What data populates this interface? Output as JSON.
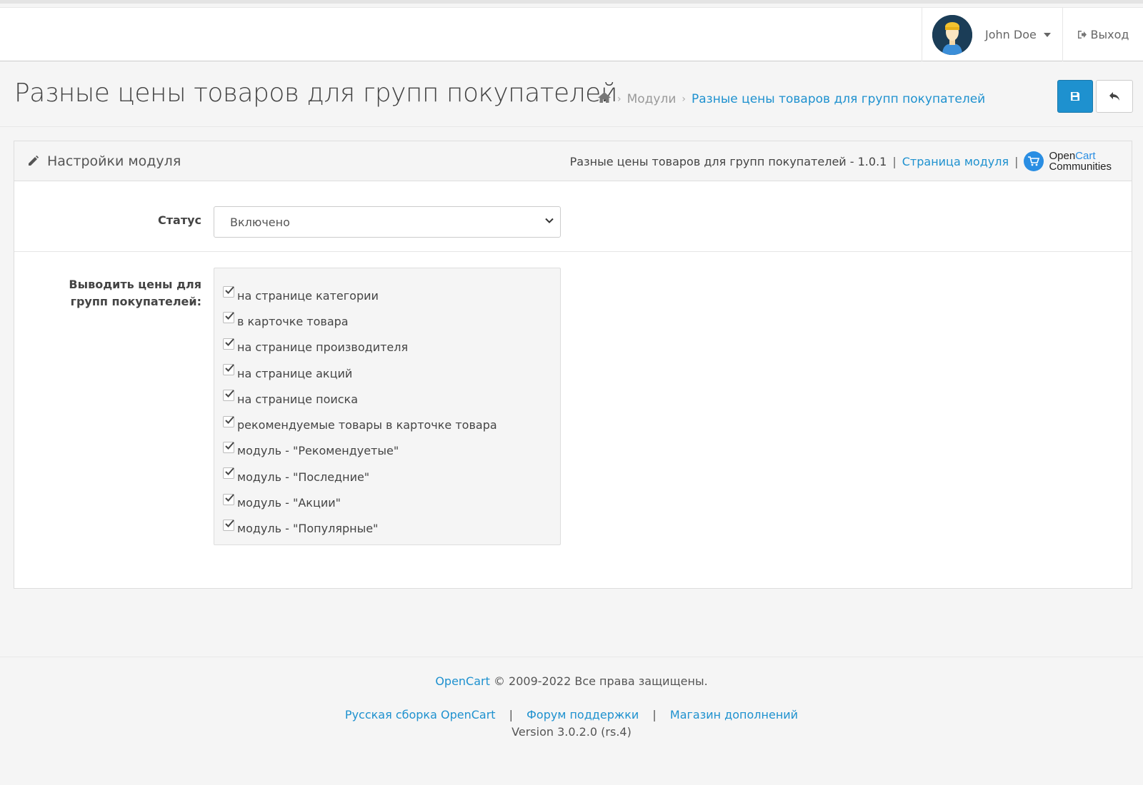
{
  "header": {
    "user_name": "John Doe",
    "logout_label": "Выход"
  },
  "page": {
    "title": "Разные цены товаров для групп покупателей",
    "breadcrumb": {
      "modules": "Модули",
      "current": "Разные цены товаров для групп покупателей"
    }
  },
  "panel": {
    "title": "Настройки модуля",
    "meta_text": "Разные цены товаров для групп покупателей - 1.0.1",
    "module_page_link": "Страница модуля",
    "logo_open": "Open",
    "logo_cart": "Cart",
    "logo_communities": "Communities"
  },
  "form": {
    "status_label": "Статус",
    "status_value": "Включено",
    "groups_label_line1": "Выводить цены для",
    "groups_label_line2": "групп покупателей:",
    "options": [
      "на странице категории",
      "в карточке товара",
      "на странице производителя",
      "на странице акций",
      "на странице поиска",
      "рекомендуемые товары в карточке товара",
      "модуль - \"Рекомендуетые\"",
      "модуль - \"Последние\"",
      "модуль - \"Акции\"",
      "модуль - \"Популярные\""
    ]
  },
  "footer": {
    "opencart_link": "OpenCart",
    "copyright": "© 2009-2022 Все права защищены.",
    "link_russian": "Русская сборка OpenCart",
    "link_forum": "Форум поддержки",
    "link_store": "Магазин дополнений",
    "separator": "|",
    "version": "Version 3.0.2.0 (rs.4)"
  },
  "colors": {
    "accent": "#1e91cf",
    "background": "#f5f5f5"
  },
  "icons": [
    "home-icon",
    "save-icon",
    "reply-icon",
    "pencil-icon",
    "sign-out-icon",
    "cart-icon",
    "checkmark-icon"
  ]
}
